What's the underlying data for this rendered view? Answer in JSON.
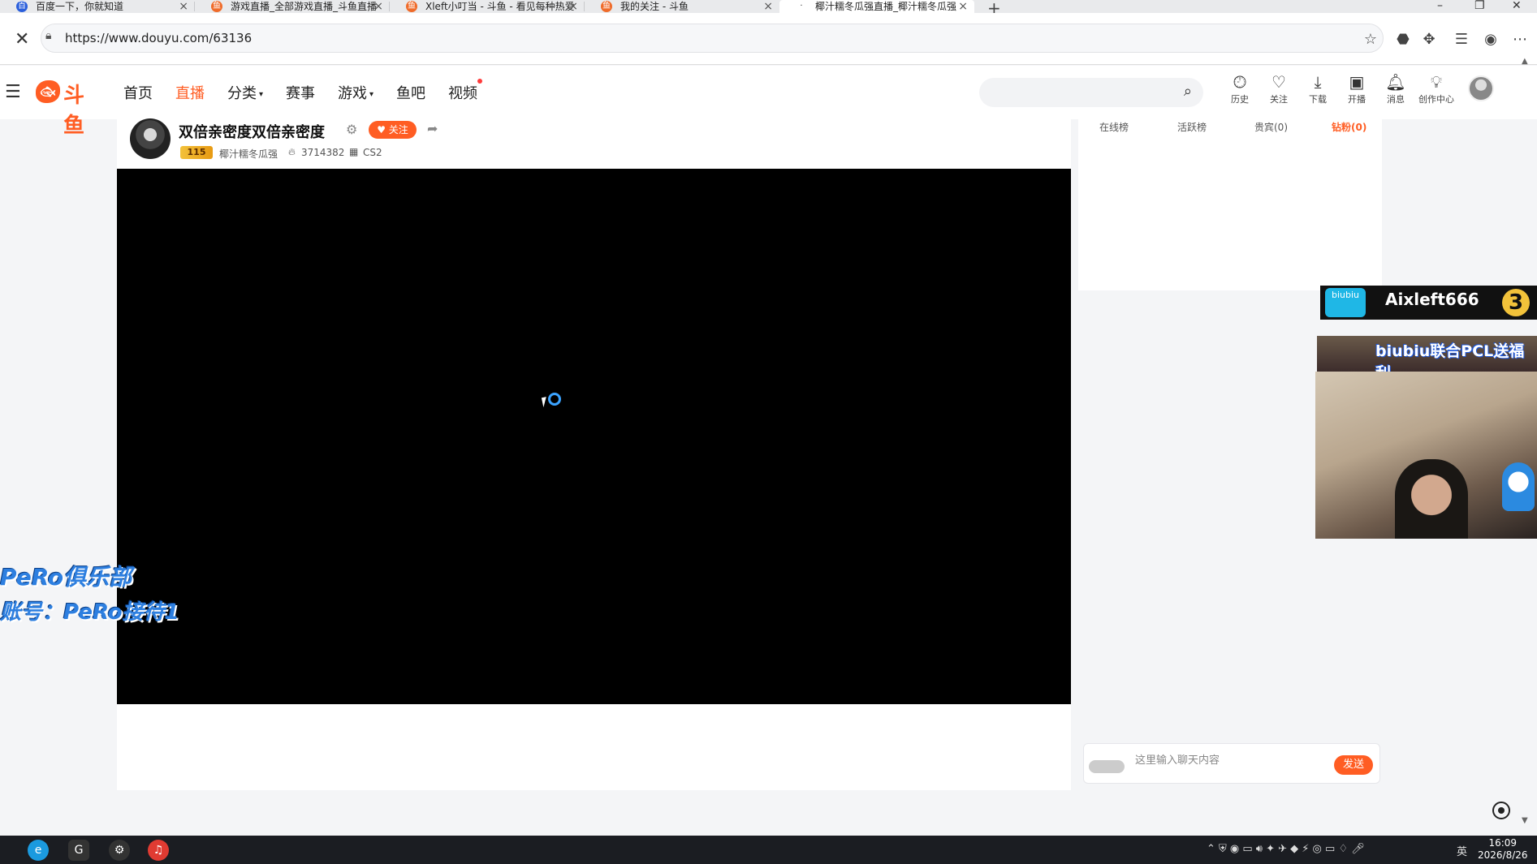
{
  "browser": {
    "tabs": [
      {
        "title": "百度一下，你就知道",
        "icon": "baidu-icon"
      },
      {
        "title": "游戏直播_全部游戏直播_斗鱼直播",
        "icon": "douyu-icon"
      },
      {
        "title": "Xleft小叮当 - 斗鱼 - 看见每种热爱",
        "icon": "douyu-icon"
      },
      {
        "title": "我的关注 - 斗鱼",
        "icon": "douyu-icon"
      },
      {
        "title": "椰汁糯冬瓜强直播_椰汁糯冬瓜强",
        "icon": "loading-icon"
      }
    ],
    "url": "https://www.douyu.com/63136"
  },
  "header": {
    "logo_text": "斗鱼",
    "nav": [
      "首页",
      "直播",
      "分类",
      "赛事",
      "游戏",
      "鱼吧",
      "视频"
    ],
    "actions": [
      "历史",
      "关注",
      "下载",
      "开播",
      "消息",
      "创作中心"
    ]
  },
  "room": {
    "title": "双倍亲密度双倍亲密度",
    "follow_label": "关注",
    "level": "115",
    "streamer": "椰汁糯冬瓜强",
    "heat": "3714382",
    "category": "CS2"
  },
  "rank_tabs": [
    "在线榜",
    "活跃榜",
    "贵宾(0)",
    "钻粉(0)"
  ],
  "chat": {
    "placeholder": "这里输入聊天内容",
    "send_label": "发送"
  },
  "overlays": {
    "promo_logo": "biubiu",
    "promo_name": "Aixleft666",
    "promo_num": "3",
    "promo2": "biubiu联合PCL送福利",
    "club_line1": "PeRo俱乐部",
    "club_line2": "账号：PeRo接待1"
  },
  "taskbar": {
    "time": "16:09",
    "date": "2026/8/26",
    "lang": "英"
  },
  "colors": {
    "accent": "#ff5d23",
    "video_bg": "#000000"
  }
}
